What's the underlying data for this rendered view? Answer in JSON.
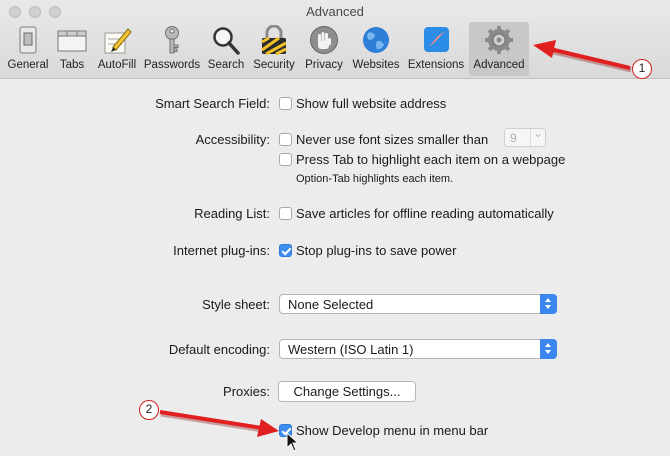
{
  "window": {
    "title": "Advanced"
  },
  "toolbar": {
    "items": [
      {
        "label": "General",
        "icon": "general-switch-icon"
      },
      {
        "label": "Tabs",
        "icon": "tabs-icon"
      },
      {
        "label": "AutoFill",
        "icon": "pencil-icon"
      },
      {
        "label": "Passwords",
        "icon": "key-icon"
      },
      {
        "label": "Search",
        "icon": "magnifier-icon"
      },
      {
        "label": "Security",
        "icon": "padlock-icon"
      },
      {
        "label": "Privacy",
        "icon": "hand-icon"
      },
      {
        "label": "Websites",
        "icon": "globe-icon"
      },
      {
        "label": "Extensions",
        "icon": "compass-icon"
      },
      {
        "label": "Advanced",
        "icon": "gear-icon",
        "selected": true
      }
    ]
  },
  "settings": {
    "smart_search": {
      "label": "Smart Search Field:",
      "option": "Show full website address",
      "checked": false
    },
    "accessibility": {
      "label": "Accessibility:",
      "font_size_option": "Never use font sizes smaller than",
      "font_size_value": "9",
      "tab_option": "Press Tab to highlight each item on a webpage",
      "tab_hint": "Option-Tab highlights each item."
    },
    "reading_list": {
      "label": "Reading List:",
      "option": "Save articles for offline reading automatically",
      "checked": false
    },
    "plugins": {
      "label": "Internet plug-ins:",
      "option": "Stop plug-ins to save power",
      "checked": true
    },
    "style_sheet": {
      "label": "Style sheet:",
      "value": "None Selected"
    },
    "encoding": {
      "label": "Default encoding:",
      "value": "Western (ISO Latin 1)"
    },
    "proxies": {
      "label": "Proxies:",
      "button": "Change Settings..."
    },
    "develop_menu": {
      "option": "Show Develop menu in menu bar",
      "checked": true
    }
  },
  "annotations": {
    "callout_1": "1",
    "callout_2": "2",
    "arrow_color": "#e02020"
  }
}
